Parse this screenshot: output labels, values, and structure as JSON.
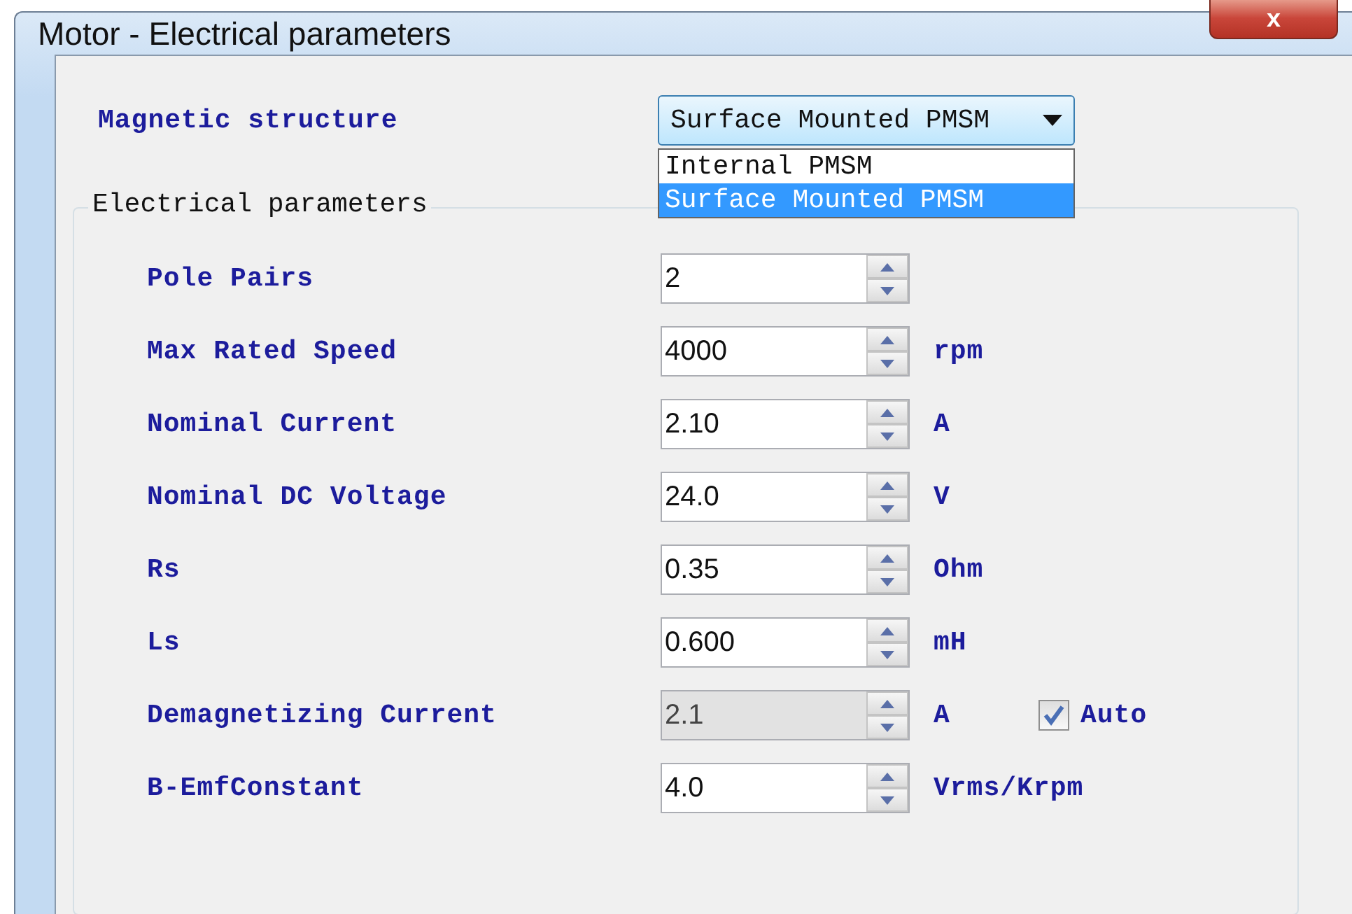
{
  "window": {
    "title": "Motor - Electrical parameters",
    "close": "x"
  },
  "magnetic_structure": {
    "label": "Magnetic structure",
    "value": "Surface Mounted PMSM",
    "expanded": true,
    "options": [
      {
        "label": "Internal PMSM",
        "selected": false
      },
      {
        "label": "Surface Mounted PMSM",
        "selected": true
      }
    ]
  },
  "group": {
    "title": "Electrical parameters",
    "rows": [
      {
        "label": "Pole Pairs",
        "value": "2",
        "disabled": false
      },
      {
        "label": "Max Rated Speed",
        "value": "4000",
        "unit": "rpm",
        "disabled": false
      },
      {
        "label": "Nominal Current",
        "value": "2.10",
        "unit": "A",
        "disabled": false
      },
      {
        "label": "Nominal DC Voltage",
        "value": "24.0",
        "unit": "V",
        "disabled": false
      },
      {
        "label": "Rs",
        "value": "0.35",
        "unit": "Ohm",
        "disabled": false
      },
      {
        "label": "Ls",
        "value": "0.600",
        "unit": "mH",
        "disabled": false
      },
      {
        "label": "Demagnetizing Current",
        "value": "2.1",
        "unit": "A",
        "disabled": true,
        "checkbox": {
          "label": "Auto",
          "checked": true
        }
      },
      {
        "label": "B-EmfConstant",
        "value": "4.0",
        "unit": "Vrms/Krpm",
        "disabled": false
      }
    ]
  }
}
